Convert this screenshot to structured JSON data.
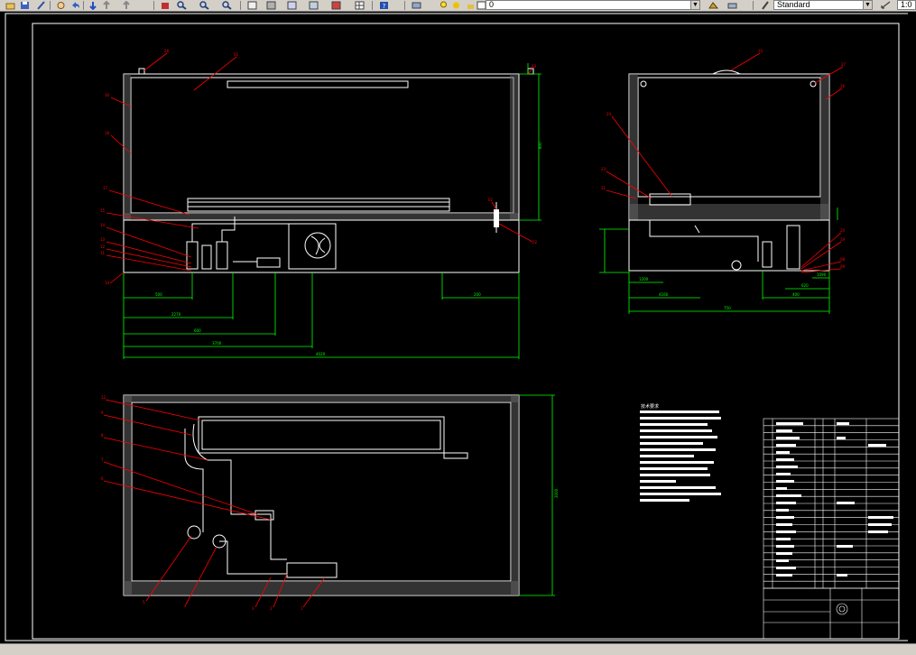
{
  "toolbar": {
    "textstyle_value": "Standard",
    "layer_value": "0",
    "scale_value": "1:0",
    "icons": [
      "open-icon",
      "save-icon",
      "pen-icon",
      "undo-icon",
      "redo-icon",
      "pan-icon",
      "zoom-realtime-icon",
      "zoom-window-icon",
      "zoom-previous-icon",
      "properties-icon",
      "design-center-icon",
      "tool-palette-icon",
      "sheet-set-icon",
      "markup-icon",
      "calculator-icon",
      "help-icon",
      "layer-properties-icon",
      "layer-state-icon",
      "make-current-icon",
      "layer-previous-icon",
      "text-style-icon",
      "dim-style-icon"
    ]
  },
  "drawing": {
    "front_view_balloons": [
      "28",
      "01",
      "16",
      "18",
      "17",
      "15",
      "14",
      "13",
      "12",
      "11",
      "10",
      "22",
      "02",
      "03"
    ],
    "side_view_balloons": [
      "25",
      "27",
      "26",
      "24",
      "23",
      "21",
      "20",
      "19",
      "08",
      "09"
    ],
    "plan_view_balloons": [
      "12",
      "9",
      "8",
      "7",
      "6",
      "5",
      "4",
      "3",
      "2",
      "1"
    ],
    "dimensions": [
      "500",
      "2270",
      "3000",
      "3700",
      "4020",
      "4160",
      "600",
      "1200",
      "800",
      "750",
      "400",
      "200",
      "620",
      "1090"
    ],
    "notes_title": "技术要求"
  },
  "colors": {
    "ui_gray": "#d4d0c8",
    "background": "#000000",
    "lines": "#ffffff",
    "dimensions": "#00ff00",
    "leaders": "#ff0000"
  }
}
